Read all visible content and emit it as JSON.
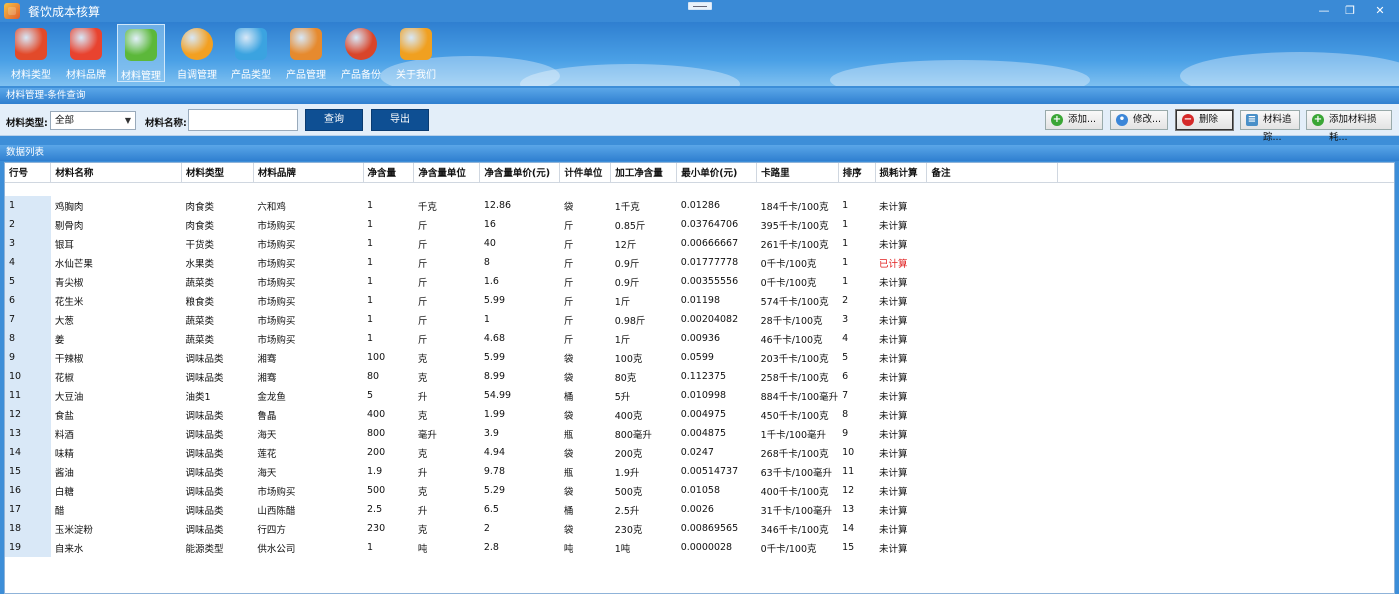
{
  "window": {
    "title": "餐饮成本核算"
  },
  "toolbar": [
    {
      "key": "material-type",
      "label": "材料类型",
      "icon": "material-type-icon",
      "color": "#e24a2a",
      "active": false
    },
    {
      "key": "material-brand",
      "label": "材料品牌",
      "icon": "material-brand-icon",
      "color": "#e8432f",
      "active": false
    },
    {
      "key": "material-manage",
      "label": "材料管理",
      "icon": "material-manage-icon",
      "color": "#5cb83a",
      "active": true
    },
    {
      "key": "self-adjust",
      "label": "自调管理",
      "icon": "self-adjust-icon",
      "color": "#f3a021",
      "active": false
    },
    {
      "key": "product-type",
      "label": "产品类型",
      "icon": "product-type-icon",
      "color": "#3ba3e0",
      "active": false
    },
    {
      "key": "product-manage",
      "label": "产品管理",
      "icon": "product-manage-icon",
      "color": "#e68a2e",
      "active": false
    },
    {
      "key": "product-backup",
      "label": "产品备份",
      "icon": "product-backup-icon",
      "color": "#d9452a",
      "active": false
    },
    {
      "key": "about",
      "label": "关于我们",
      "icon": "lightning-icon",
      "color": "#f0a020",
      "active": false
    }
  ],
  "filter": {
    "header": "材料管理-条件查询",
    "type_label": "材料类型:",
    "type_value": "全部",
    "name_label": "材料名称:",
    "name_value": "",
    "query_label": "查询",
    "export_label": "导出",
    "add_label": "添加...",
    "edit_label": "修改...",
    "delete_label": "删除",
    "trace_label": "材料追踪...",
    "add_loss_label": "添加材料损耗..."
  },
  "grid": {
    "header": "数据列表",
    "columns": [
      "行号",
      "材料名称",
      "材料类型",
      "材料品牌",
      "净含量",
      "净含量单位",
      "净含量单价(元)",
      "计件单位",
      "加工净含量",
      "最小单价(元)",
      "卡路里",
      "排序",
      "损耗计算",
      "备注"
    ],
    "rows": [
      [
        "1",
        "鸡胸肉",
        "肉食类",
        "六和鸡",
        "1",
        "千克",
        "12.86",
        "袋",
        "1千克",
        "0.01286",
        "184千卡/100克",
        "1",
        "未计算",
        ""
      ],
      [
        "2",
        "剔骨肉",
        "肉食类",
        "市场购买",
        "1",
        "斤",
        "16",
        "斤",
        "0.85斤",
        "0.03764706",
        "395千卡/100克",
        "1",
        "未计算",
        ""
      ],
      [
        "3",
        "银耳",
        "干货类",
        "市场购买",
        "1",
        "斤",
        "40",
        "斤",
        "12斤",
        "0.00666667",
        "261千卡/100克",
        "1",
        "未计算",
        ""
      ],
      [
        "4",
        "水仙芒果",
        "水果类",
        "市场购买",
        "1",
        "斤",
        "8",
        "斤",
        "0.9斤",
        "0.01777778",
        "0千卡/100克",
        "1",
        "已计算",
        ""
      ],
      [
        "5",
        "青尖椒",
        "蔬菜类",
        "市场购买",
        "1",
        "斤",
        "1.6",
        "斤",
        "0.9斤",
        "0.00355556",
        "0千卡/100克",
        "1",
        "未计算",
        ""
      ],
      [
        "6",
        "花生米",
        "粮食类",
        "市场购买",
        "1",
        "斤",
        "5.99",
        "斤",
        "1斤",
        "0.01198",
        "574千卡/100克",
        "2",
        "未计算",
        ""
      ],
      [
        "7",
        "大葱",
        "蔬菜类",
        "市场购买",
        "1",
        "斤",
        "1",
        "斤",
        "0.98斤",
        "0.00204082",
        "28千卡/100克",
        "3",
        "未计算",
        ""
      ],
      [
        "8",
        "姜",
        "蔬菜类",
        "市场购买",
        "1",
        "斤",
        "4.68",
        "斤",
        "1斤",
        "0.00936",
        "46千卡/100克",
        "4",
        "未计算",
        ""
      ],
      [
        "9",
        "干辣椒",
        "调味品类",
        "湘骞",
        "100",
        "克",
        "5.99",
        "袋",
        "100克",
        "0.0599",
        "203千卡/100克",
        "5",
        "未计算",
        ""
      ],
      [
        "10",
        "花椒",
        "调味品类",
        "湘骞",
        "80",
        "克",
        "8.99",
        "袋",
        "80克",
        "0.112375",
        "258千卡/100克",
        "6",
        "未计算",
        ""
      ],
      [
        "11",
        "大豆油",
        "油类1",
        "金龙鱼",
        "5",
        "升",
        "54.99",
        "桶",
        "5升",
        "0.010998",
        "884千卡/100毫升",
        "7",
        "未计算",
        ""
      ],
      [
        "12",
        "食盐",
        "调味品类",
        "鲁晶",
        "400",
        "克",
        "1.99",
        "袋",
        "400克",
        "0.004975",
        "450千卡/100克",
        "8",
        "未计算",
        ""
      ],
      [
        "13",
        "料酒",
        "调味品类",
        "海天",
        "800",
        "毫升",
        "3.9",
        "瓶",
        "800毫升",
        "0.004875",
        "1千卡/100毫升",
        "9",
        "未计算",
        ""
      ],
      [
        "14",
        "味精",
        "调味品类",
        "莲花",
        "200",
        "克",
        "4.94",
        "袋",
        "200克",
        "0.0247",
        "268千卡/100克",
        "10",
        "未计算",
        ""
      ],
      [
        "15",
        "酱油",
        "调味品类",
        "海天",
        "1.9",
        "升",
        "9.78",
        "瓶",
        "1.9升",
        "0.00514737",
        "63千卡/100毫升",
        "11",
        "未计算",
        ""
      ],
      [
        "16",
        "白糖",
        "调味品类",
        "市场购买",
        "500",
        "克",
        "5.29",
        "袋",
        "500克",
        "0.01058",
        "400千卡/100克",
        "12",
        "未计算",
        ""
      ],
      [
        "17",
        "醋",
        "调味品类",
        "山西陈醋",
        "2.5",
        "升",
        "6.5",
        "桶",
        "2.5升",
        "0.0026",
        "31千卡/100毫升",
        "13",
        "未计算",
        ""
      ],
      [
        "18",
        "玉米淀粉",
        "调味品类",
        "行四方",
        "230",
        "克",
        "2",
        "袋",
        "230克",
        "0.00869565",
        "346千卡/100克",
        "14",
        "未计算",
        ""
      ],
      [
        "19",
        "自来水",
        "能源类型",
        " 供水公司",
        "1",
        "吨",
        "2.8",
        "吨",
        "1吨",
        "0.0000028",
        "0千卡/100克",
        "15",
        "未计算",
        ""
      ]
    ]
  }
}
